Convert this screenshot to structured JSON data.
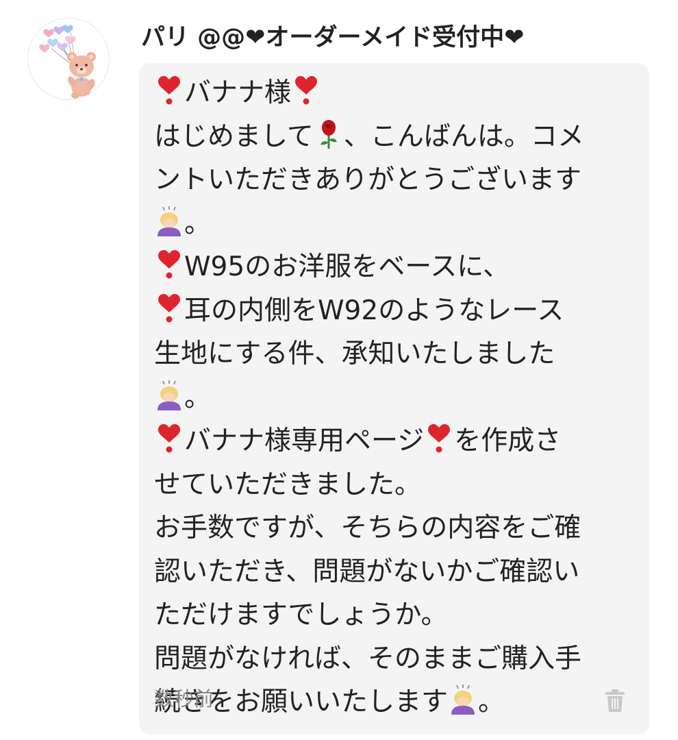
{
  "user": {
    "name": "パリ @@❤オーダーメイド受付中❤",
    "avatar_icon": "teddy-bear-with-balloons-icon"
  },
  "message": {
    "lines": [
      [
        "heart-exclamation",
        "バナナ様",
        "heart-exclamation"
      ],
      [
        "はじめまして",
        "rose",
        "、こんばんは。コメ"
      ],
      [
        "ントいただきありがとうございます"
      ],
      [
        "bowing-woman",
        "。"
      ],
      [
        "heart-exclamation",
        "W95のお洋服をベースに、"
      ],
      [
        "heart-exclamation",
        "耳の内側をW92のようなレース"
      ],
      [
        "生地にする件、承知いたしました"
      ],
      [
        "bowing-woman",
        "。"
      ],
      [
        "heart-exclamation",
        "バナナ様専用ページ",
        "heart-exclamation",
        "を作成さ"
      ],
      [
        "せていただきました。"
      ],
      [
        "お手数ですが、そちらの内容をご確"
      ],
      [
        "認いただき、問題がないかご確認い"
      ],
      [
        "ただけますでしょうか。"
      ],
      [
        "問題がなければ、そのままご購入手"
      ],
      [
        "続きをお願いいたします",
        "bowing-woman",
        "。"
      ]
    ],
    "text": {
      "l1_a": "バナナ様",
      "l2_a": "はじめまして",
      "l2_b": "、こんばんは。コメ",
      "l3": "ントいただきありがとうございます",
      "l4": "。",
      "l5": "W95のお洋服をベースに、",
      "l6": "耳の内側をW92のようなレース",
      "l7": "生地にする件、承知いたしました",
      "l8": "。",
      "l9_a": "バナナ様専用ページ",
      "l9_b": "を作成さ",
      "l10": "せていただきました。",
      "l11": "お手数ですが、そちらの内容をご確",
      "l12": "認いただき、問題がないかご確認い",
      "l13": "ただけますでしょうか。",
      "l14": "問題がなければ、そのままご購入手",
      "l15_a": "続きをお願いいたします",
      "l15_b": "。"
    },
    "timestamp": "数秒前",
    "delete_icon": "trash-icon"
  },
  "colors": {
    "bubble_bg": "#f4f4f4",
    "text": "#222222",
    "timestamp": "#888888",
    "heart_red": "#e0242e",
    "trash_gray": "#c8c8c8"
  }
}
